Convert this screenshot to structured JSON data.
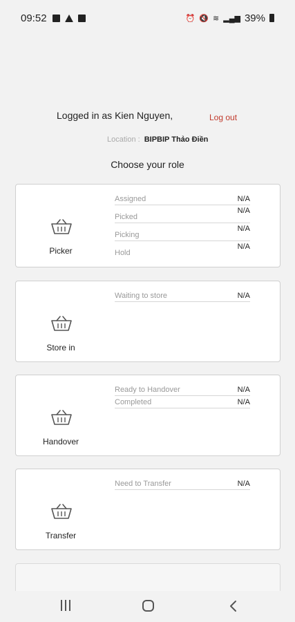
{
  "status_bar": {
    "time": "09:52",
    "battery": "39%",
    "icons": [
      "gallery-icon",
      "telegram-icon",
      "app-icon",
      "alarm-icon",
      "mute-icon",
      "wifi-icon",
      "signal-icon",
      "battery-icon"
    ]
  },
  "header": {
    "logged_in_text": "Logged in as Kien Nguyen,",
    "logout_label": "Log out",
    "location_label": "Location :",
    "location_value": "BIPBIP Thảo Điền",
    "choose_role_text": "Choose your role"
  },
  "roles": [
    {
      "label": "Picker",
      "icon": "basket-icon",
      "stats": [
        {
          "label": "Assigned",
          "value": "N/A"
        },
        {
          "label": "Picked",
          "value": "N/A"
        },
        {
          "label": "Picking",
          "value": "N/A"
        },
        {
          "label": "Hold",
          "value": "N/A"
        }
      ]
    },
    {
      "label": "Store in",
      "icon": "basket-icon",
      "stats": [
        {
          "label": "Waiting to store",
          "value": "N/A"
        }
      ]
    },
    {
      "label": "Handover",
      "icon": "basket-icon",
      "stats": [
        {
          "label": "Ready to Handover",
          "value": "N/A"
        },
        {
          "label": "Completed",
          "value": "N/A"
        }
      ]
    },
    {
      "label": "Transfer",
      "icon": "basket-icon",
      "stats": [
        {
          "label": "Need to Transfer",
          "value": "N/A"
        }
      ]
    }
  ],
  "colors": {
    "background": "#f2f2f2",
    "card": "#ffffff",
    "logout": "#c0392b",
    "muted_text": "#999999"
  }
}
